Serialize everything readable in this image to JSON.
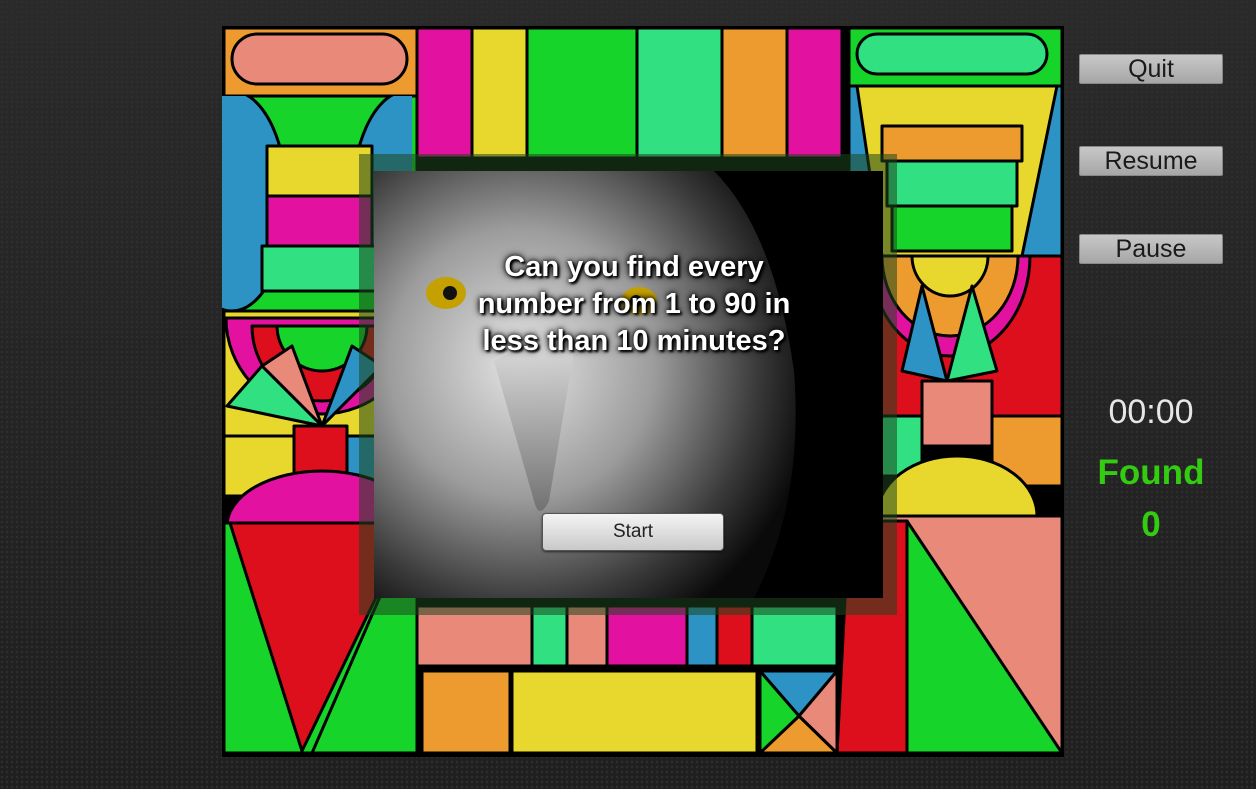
{
  "game": {
    "question": "Can you find every number from 1 to 90 in less than 10 minutes?",
    "start_label": "Start"
  },
  "sidebar": {
    "quit_label": "Quit",
    "resume_label": "Resume",
    "pause_label": "Pause",
    "timer": "00:00",
    "found_label": "Found",
    "found_count": "0"
  },
  "colors": {
    "found_text": "#33cc11",
    "board_border": "#000000",
    "panel_button": "#b9b9b9"
  }
}
